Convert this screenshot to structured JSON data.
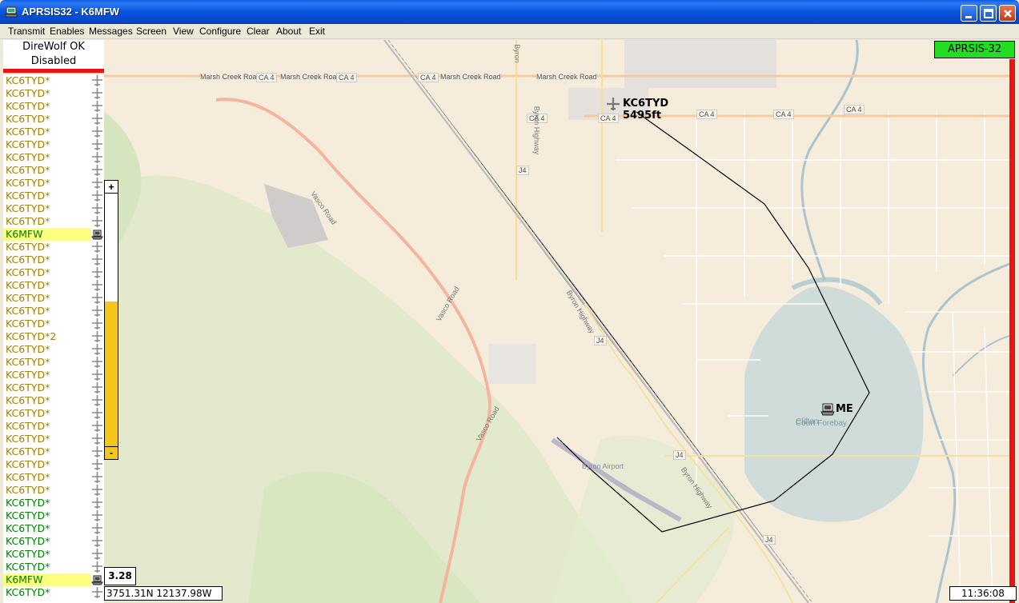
{
  "window": {
    "title": "APRSIS32 - K6MFW"
  },
  "menu": [
    "Transmit",
    "Enables",
    "Messages",
    "Screen",
    "View",
    "Configure",
    "Clear",
    "About",
    "Exit"
  ],
  "status": {
    "line1": "DireWolf OK",
    "line2": "Disabled"
  },
  "stations": [
    {
      "call": "KC6TYD*",
      "style": "olive",
      "icon": "plane"
    },
    {
      "call": "KC6TYD*",
      "style": "olive",
      "icon": "plane"
    },
    {
      "call": "KC6TYD*",
      "style": "olive",
      "icon": "plane"
    },
    {
      "call": "KC6TYD*",
      "style": "olive",
      "icon": "plane"
    },
    {
      "call": "KC6TYD*",
      "style": "olive",
      "icon": "plane"
    },
    {
      "call": "KC6TYD*",
      "style": "olive",
      "icon": "plane"
    },
    {
      "call": "KC6TYD*",
      "style": "olive",
      "icon": "plane"
    },
    {
      "call": "KC6TYD*",
      "style": "olive",
      "icon": "plane"
    },
    {
      "call": "KC6TYD*",
      "style": "olive",
      "icon": "plane"
    },
    {
      "call": "KC6TYD*",
      "style": "olive",
      "icon": "plane"
    },
    {
      "call": "KC6TYD*",
      "style": "olive",
      "icon": "plane"
    },
    {
      "call": "KC6TYD*",
      "style": "olive",
      "icon": "plane"
    },
    {
      "call": "K6MFW",
      "style": "hl",
      "icon": "laptop"
    },
    {
      "call": "KC6TYD*",
      "style": "olive",
      "icon": "plane"
    },
    {
      "call": "KC6TYD*",
      "style": "olive",
      "icon": "plane"
    },
    {
      "call": "KC6TYD*",
      "style": "olive",
      "icon": "plane"
    },
    {
      "call": "KC6TYD*",
      "style": "olive",
      "icon": "plane"
    },
    {
      "call": "KC6TYD*",
      "style": "olive",
      "icon": "plane"
    },
    {
      "call": "KC6TYD*",
      "style": "olive",
      "icon": "plane"
    },
    {
      "call": "KC6TYD*",
      "style": "olive",
      "icon": "plane"
    },
    {
      "call": "KC6TYD*2",
      "style": "olive",
      "icon": "plane"
    },
    {
      "call": "KC6TYD*",
      "style": "olive",
      "icon": "plane"
    },
    {
      "call": "KC6TYD*",
      "style": "olive",
      "icon": "plane"
    },
    {
      "call": "KC6TYD*",
      "style": "olive",
      "icon": "plane"
    },
    {
      "call": "KC6TYD*",
      "style": "olive",
      "icon": "plane"
    },
    {
      "call": "KC6TYD*",
      "style": "olive",
      "icon": "plane"
    },
    {
      "call": "KC6TYD*",
      "style": "olive",
      "icon": "plane"
    },
    {
      "call": "KC6TYD*",
      "style": "olive",
      "icon": "plane"
    },
    {
      "call": "KC6TYD*",
      "style": "olive",
      "icon": "plane"
    },
    {
      "call": "KC6TYD*",
      "style": "olive",
      "icon": "plane"
    },
    {
      "call": "KC6TYD*",
      "style": "olive",
      "icon": "plane"
    },
    {
      "call": "KC6TYD*",
      "style": "olive",
      "icon": "plane"
    },
    {
      "call": "KC6TYD*",
      "style": "olive",
      "icon": "plane"
    },
    {
      "call": "KC6TYD*",
      "style": "green",
      "icon": "plane"
    },
    {
      "call": "KC6TYD*",
      "style": "green",
      "icon": "plane"
    },
    {
      "call": "KC6TYD*",
      "style": "green",
      "icon": "plane"
    },
    {
      "call": "KC6TYD*",
      "style": "green",
      "icon": "plane"
    },
    {
      "call": "KC6TYD*",
      "style": "green",
      "icon": "plane"
    },
    {
      "call": "KC6TYD*",
      "style": "green",
      "icon": "plane"
    },
    {
      "call": "K6MFW",
      "style": "hl",
      "icon": "laptop"
    },
    {
      "call": "KC6TYD*",
      "style": "green",
      "icon": "plane"
    }
  ],
  "zoom": {
    "plus_label": "+",
    "minus_label": "-",
    "level_fraction": 0.55
  },
  "map": {
    "scale": "3.28",
    "coordinates": "3751.31N 12137.98W",
    "clock": "11:36:08",
    "badge": "APRSIS-32",
    "badge_color": "#22dd22",
    "track_color": "#000000",
    "plane_callsign": "KC6TYD",
    "plane_altitude": "5495ft",
    "me_label": "ME",
    "road_labels": {
      "ca4": "CA 4",
      "marsh_creek": "Marsh Creek Road",
      "vasco": "Vasco Road",
      "byron_hwy": "Byron Highway",
      "byron": "Byron",
      "j4": "J4",
      "byron_airport": "Byron Airport",
      "clifton": "Clifton",
      "court_forebay": "Court Forebay"
    }
  }
}
